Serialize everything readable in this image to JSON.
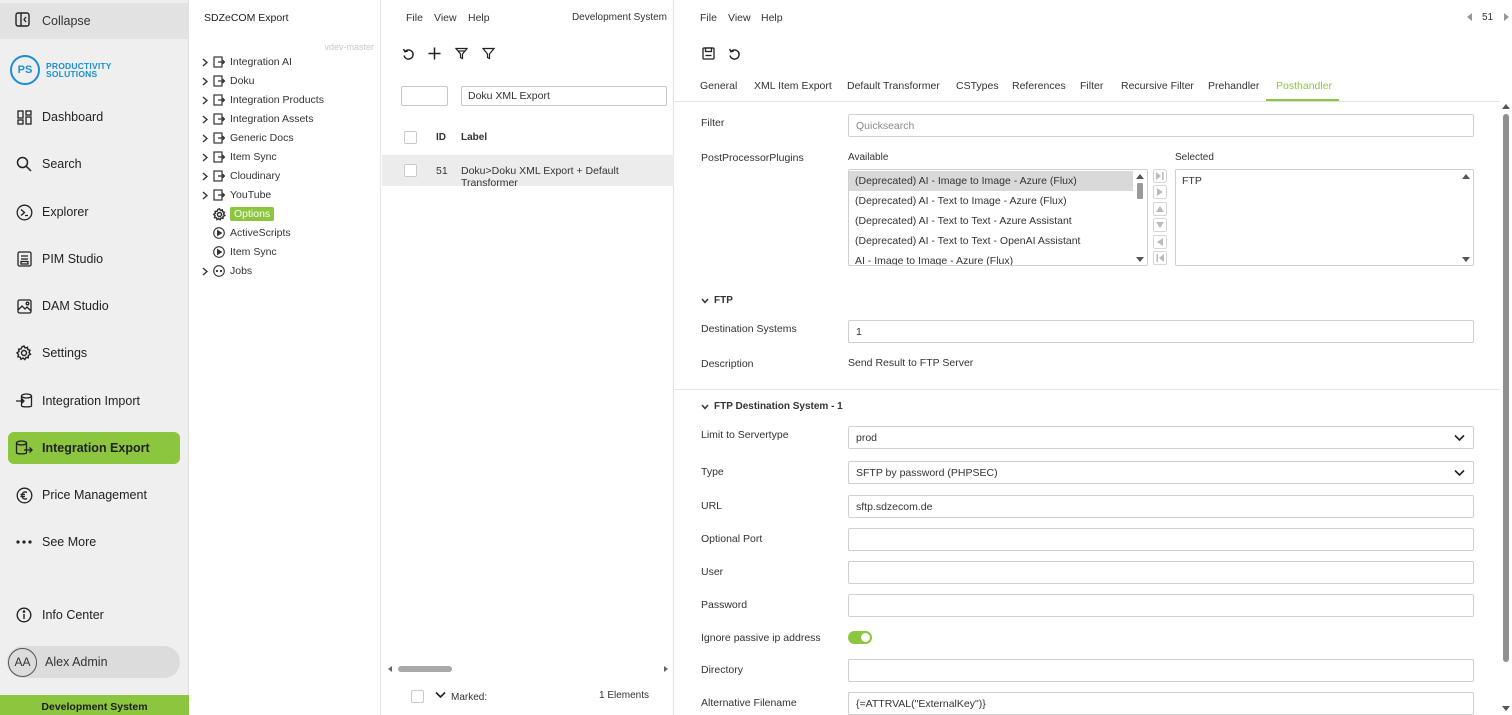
{
  "sidebar": {
    "collapse_label": "Collapse",
    "logo": {
      "initials": "PS",
      "line1": "PRODUCTIVITY",
      "line2": "SOLUTIONS"
    },
    "items": [
      {
        "label": "Dashboard",
        "icon": "dashboard-icon"
      },
      {
        "label": "Search",
        "icon": "search-icon"
      },
      {
        "label": "Explorer",
        "icon": "explorer-icon"
      },
      {
        "label": "PIM Studio",
        "icon": "pim-studio-icon"
      },
      {
        "label": "DAM Studio",
        "icon": "dam-studio-icon"
      },
      {
        "label": "Settings",
        "icon": "gear-icon"
      },
      {
        "label": "Integration Import",
        "icon": "import-icon"
      },
      {
        "label": "Integration Export",
        "icon": "export-icon"
      },
      {
        "label": "Price Management",
        "icon": "euro-icon"
      },
      {
        "label": "See More",
        "icon": "more-icon"
      }
    ],
    "active_item": "Integration Export",
    "info_center": "Info Center",
    "user": {
      "initials": "AA",
      "name": "Alex Admin"
    },
    "environment": "Development System",
    "accent_color": "#8cc63f"
  },
  "tree": {
    "title": "SDZeCOM Export",
    "version": "vdev-master",
    "nodes": [
      {
        "label": "Integration AI",
        "icon": "export-node-icon"
      },
      {
        "label": "Doku",
        "icon": "export-node-icon"
      },
      {
        "label": "Integration Products",
        "icon": "export-node-icon"
      },
      {
        "label": "Integration Assets",
        "icon": "export-node-icon"
      },
      {
        "label": "Generic Docs",
        "icon": "export-node-icon"
      },
      {
        "label": "Item Sync",
        "icon": "export-node-icon"
      },
      {
        "label": "Cloudinary",
        "icon": "export-node-icon"
      },
      {
        "label": "YouTube",
        "icon": "export-node-icon"
      },
      {
        "label": "Options",
        "icon": "gear-icon"
      },
      {
        "label": "ActiveScripts",
        "icon": "play-circle-icon"
      },
      {
        "label": "Item Sync",
        "icon": "play-circle-icon"
      },
      {
        "label": "Jobs",
        "icon": "jobs-icon"
      }
    ]
  },
  "list": {
    "menu": [
      "File",
      "View",
      "Help"
    ],
    "environment": "Development System",
    "filter_value": "Doku XML Export",
    "columns": {
      "id": "ID",
      "label": "Label"
    },
    "rows": [
      {
        "id": "51",
        "label": "Doku>Doku XML Export + Default Transformer"
      }
    ],
    "footer": {
      "marked": "Marked:",
      "count": "1 Elements"
    }
  },
  "detail": {
    "menu": [
      "File",
      "View",
      "Help"
    ],
    "record_id": "51",
    "tabs": [
      "General",
      "XML Item Export",
      "Default Transformer",
      "CSTypes",
      "References",
      "Filter",
      "Recursive Filter",
      "Prehandler",
      "Posthandler"
    ],
    "active_tab": "Posthandler",
    "filter": {
      "label": "Filter",
      "placeholder": "Quicksearch"
    },
    "plugins": {
      "label": "PostProcessorPlugins",
      "available_label": "Available",
      "selected_label": "Selected",
      "available": [
        "(Deprecated) AI - Image to Image - Azure (Flux)",
        "(Deprecated) AI - Text to Image - Azure (Flux)",
        "(Deprecated) AI - Text to Text - Azure Assistant",
        "(Deprecated) AI - Text to Text - OpenAI Assistant",
        "AI - Image to Image - Azure (Flux)"
      ],
      "selected": [
        "FTP"
      ]
    },
    "ftp": {
      "title": "FTP",
      "destination_systems_label": "Destination Systems",
      "destination_systems": "1",
      "description_label": "Description",
      "description": "Send Result to FTP Server"
    },
    "ftp_dest": {
      "title": "FTP Destination System - 1",
      "servertype_label": "Limit to Servertype",
      "servertype": "prod",
      "type_label": "Type",
      "type": "SFTP by password (PHPSEC)",
      "url_label": "URL",
      "url": "sftp.sdzecom.de",
      "port_label": "Optional Port",
      "port": "",
      "user_label": "User",
      "user": "",
      "password_label": "Password",
      "password": "",
      "passive_label": "Ignore passive ip address",
      "passive": true,
      "directory_label": "Directory",
      "directory": "",
      "altfile_label": "Alternative Filename",
      "altfile": "{=ATTRVAL(\"ExternalKey\")}"
    }
  }
}
